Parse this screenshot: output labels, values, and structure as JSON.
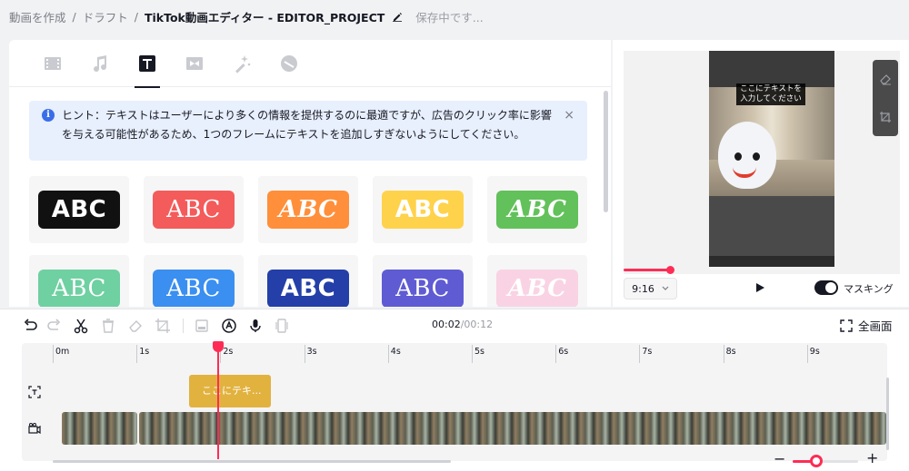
{
  "breadcrumb": {
    "items": [
      "動画を作成",
      "ドラフト"
    ],
    "separator": "/",
    "current": "TikTok動画エディター - EDITOR_PROJECT",
    "status": "保存中です..."
  },
  "tabs": [
    {
      "name": "media",
      "icon": "film-icon"
    },
    {
      "name": "music",
      "icon": "music-note-icon"
    },
    {
      "name": "text",
      "icon": "text-icon",
      "active": true
    },
    {
      "name": "transition",
      "icon": "transition-icon"
    },
    {
      "name": "effects",
      "icon": "magic-wand-icon"
    },
    {
      "name": "stickers",
      "icon": "sticker-icon"
    }
  ],
  "hint": {
    "text": "ヒント：テキストはユーザーにより多くの情報を提供するのに最適ですが、広告のクリック率に影響を与える可能性があるため、1つのフレームにテキストを追加しすぎないようにしてください。",
    "close": "×",
    "info_glyph": "i"
  },
  "text_styles": [
    {
      "label": "ABC",
      "bg": "#111111",
      "fg": "#ffffff",
      "font": "sans"
    },
    {
      "label": "ABC",
      "bg": "#f45b5b",
      "fg": "#ffffff",
      "font": "serif"
    },
    {
      "label": "ABC",
      "bg": "#ff8f3a",
      "fg": "#ffffff",
      "font": "serif-italic"
    },
    {
      "label": "ABC",
      "bg": "#ffd24c",
      "fg": "#ffffff",
      "font": "sans"
    },
    {
      "label": "ABC",
      "bg": "#62c15a",
      "fg": "#ffffff",
      "font": "serif-italic"
    },
    {
      "label": "ABC",
      "bg": "#6fd0a2",
      "fg": "#ffffff",
      "font": "serif"
    },
    {
      "label": "ABC",
      "bg": "#3a8ff0",
      "fg": "#ffffff",
      "font": "serif"
    },
    {
      "label": "ABC",
      "bg": "#243fa8",
      "fg": "#ffffff",
      "font": "sans"
    },
    {
      "label": "ABC",
      "bg": "#5f5bd3",
      "fg": "#ffffff",
      "font": "serif"
    },
    {
      "label": "ABC",
      "bg": "#f9d3e3",
      "fg": "#ffffff",
      "font": "serif-italic"
    }
  ],
  "preview": {
    "caption": "ここにテキストを 入力してください",
    "ratio": "9:16",
    "masking_label": "マスキング",
    "masking_on": true,
    "progress": 0.2
  },
  "toolbar": {
    "current_time": "00:02",
    "total_time": "/00:12",
    "fullscreen_label": "全画面"
  },
  "timeline": {
    "ticks": [
      "0m",
      "1s",
      "2s",
      "3s",
      "4s",
      "5s",
      "6s",
      "7s",
      "8s",
      "9s"
    ],
    "text_clip_label": "ここにテキ...",
    "zoom_minus": "−",
    "zoom_plus": "+",
    "zoom_level": 0.4
  },
  "colors": {
    "accent": "#fe2c55",
    "text_clip": "#e2b23f",
    "hint_bg": "#e8effd",
    "info": "#3a6ee8"
  }
}
